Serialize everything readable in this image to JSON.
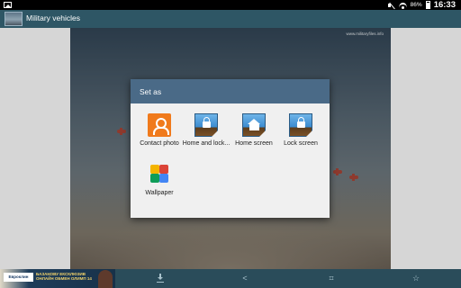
{
  "status_bar": {
    "battery": "86%",
    "time": "16:33"
  },
  "app_bar": {
    "title": "Military vehicles"
  },
  "photo": {
    "watermark": "www.militaryfiles.info"
  },
  "dialog": {
    "title": "Set as",
    "options": [
      {
        "label": "Contact photo",
        "icon": "contact-icon"
      },
      {
        "label": "Home and lock...",
        "icon": "home-lock-screen-icon"
      },
      {
        "label": "Home screen",
        "icon": "home-screen-icon"
      },
      {
        "label": "Lock screen",
        "icon": "lock-screen-icon"
      },
      {
        "label": "Wallpaper",
        "icon": "wallpaper-icon"
      }
    ]
  },
  "ad": {
    "logo": "Евроклин",
    "text": "БАЗАНОВУ ЕКСКЛЮЗИВ ОНЛАЙН ОБМЕН ОЛИМП 14"
  },
  "bottom_bar": {
    "icons": [
      "download-icon",
      "share-icon",
      "crop-icon",
      "star-icon"
    ]
  },
  "colors": {
    "action_bar": "#2e5665",
    "dialog_header": "#4a6a87",
    "bottom_bar": "#2a4c5a"
  }
}
